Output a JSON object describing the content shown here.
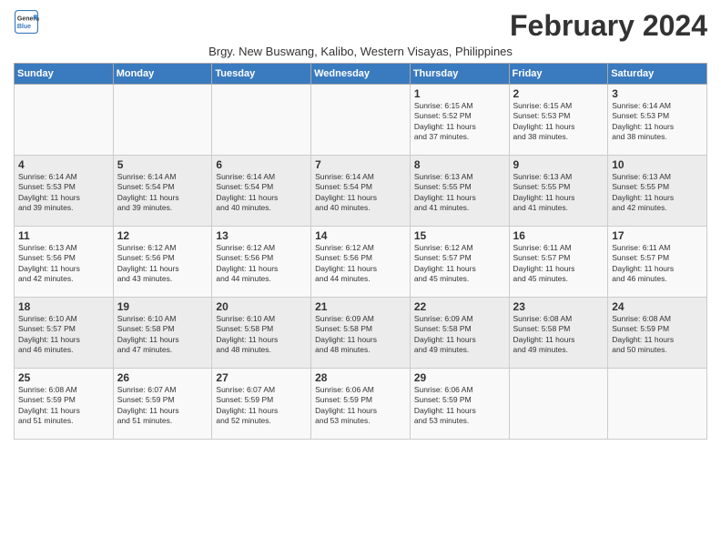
{
  "logo": {
    "line1": "General",
    "line2": "Blue"
  },
  "title": "February 2024",
  "subtitle": "Brgy. New Buswang, Kalibo, Western Visayas, Philippines",
  "weekdays": [
    "Sunday",
    "Monday",
    "Tuesday",
    "Wednesday",
    "Thursday",
    "Friday",
    "Saturday"
  ],
  "weeks": [
    [
      {
        "day": "",
        "info": ""
      },
      {
        "day": "",
        "info": ""
      },
      {
        "day": "",
        "info": ""
      },
      {
        "day": "",
        "info": ""
      },
      {
        "day": "1",
        "info": "Sunrise: 6:15 AM\nSunset: 5:52 PM\nDaylight: 11 hours\nand 37 minutes."
      },
      {
        "day": "2",
        "info": "Sunrise: 6:15 AM\nSunset: 5:53 PM\nDaylight: 11 hours\nand 38 minutes."
      },
      {
        "day": "3",
        "info": "Sunrise: 6:14 AM\nSunset: 5:53 PM\nDaylight: 11 hours\nand 38 minutes."
      }
    ],
    [
      {
        "day": "4",
        "info": "Sunrise: 6:14 AM\nSunset: 5:53 PM\nDaylight: 11 hours\nand 39 minutes."
      },
      {
        "day": "5",
        "info": "Sunrise: 6:14 AM\nSunset: 5:54 PM\nDaylight: 11 hours\nand 39 minutes."
      },
      {
        "day": "6",
        "info": "Sunrise: 6:14 AM\nSunset: 5:54 PM\nDaylight: 11 hours\nand 40 minutes."
      },
      {
        "day": "7",
        "info": "Sunrise: 6:14 AM\nSunset: 5:54 PM\nDaylight: 11 hours\nand 40 minutes."
      },
      {
        "day": "8",
        "info": "Sunrise: 6:13 AM\nSunset: 5:55 PM\nDaylight: 11 hours\nand 41 minutes."
      },
      {
        "day": "9",
        "info": "Sunrise: 6:13 AM\nSunset: 5:55 PM\nDaylight: 11 hours\nand 41 minutes."
      },
      {
        "day": "10",
        "info": "Sunrise: 6:13 AM\nSunset: 5:55 PM\nDaylight: 11 hours\nand 42 minutes."
      }
    ],
    [
      {
        "day": "11",
        "info": "Sunrise: 6:13 AM\nSunset: 5:56 PM\nDaylight: 11 hours\nand 42 minutes."
      },
      {
        "day": "12",
        "info": "Sunrise: 6:12 AM\nSunset: 5:56 PM\nDaylight: 11 hours\nand 43 minutes."
      },
      {
        "day": "13",
        "info": "Sunrise: 6:12 AM\nSunset: 5:56 PM\nDaylight: 11 hours\nand 44 minutes."
      },
      {
        "day": "14",
        "info": "Sunrise: 6:12 AM\nSunset: 5:56 PM\nDaylight: 11 hours\nand 44 minutes."
      },
      {
        "day": "15",
        "info": "Sunrise: 6:12 AM\nSunset: 5:57 PM\nDaylight: 11 hours\nand 45 minutes."
      },
      {
        "day": "16",
        "info": "Sunrise: 6:11 AM\nSunset: 5:57 PM\nDaylight: 11 hours\nand 45 minutes."
      },
      {
        "day": "17",
        "info": "Sunrise: 6:11 AM\nSunset: 5:57 PM\nDaylight: 11 hours\nand 46 minutes."
      }
    ],
    [
      {
        "day": "18",
        "info": "Sunrise: 6:10 AM\nSunset: 5:57 PM\nDaylight: 11 hours\nand 46 minutes."
      },
      {
        "day": "19",
        "info": "Sunrise: 6:10 AM\nSunset: 5:58 PM\nDaylight: 11 hours\nand 47 minutes."
      },
      {
        "day": "20",
        "info": "Sunrise: 6:10 AM\nSunset: 5:58 PM\nDaylight: 11 hours\nand 48 minutes."
      },
      {
        "day": "21",
        "info": "Sunrise: 6:09 AM\nSunset: 5:58 PM\nDaylight: 11 hours\nand 48 minutes."
      },
      {
        "day": "22",
        "info": "Sunrise: 6:09 AM\nSunset: 5:58 PM\nDaylight: 11 hours\nand 49 minutes."
      },
      {
        "day": "23",
        "info": "Sunrise: 6:08 AM\nSunset: 5:58 PM\nDaylight: 11 hours\nand 49 minutes."
      },
      {
        "day": "24",
        "info": "Sunrise: 6:08 AM\nSunset: 5:59 PM\nDaylight: 11 hours\nand 50 minutes."
      }
    ],
    [
      {
        "day": "25",
        "info": "Sunrise: 6:08 AM\nSunset: 5:59 PM\nDaylight: 11 hours\nand 51 minutes."
      },
      {
        "day": "26",
        "info": "Sunrise: 6:07 AM\nSunset: 5:59 PM\nDaylight: 11 hours\nand 51 minutes."
      },
      {
        "day": "27",
        "info": "Sunrise: 6:07 AM\nSunset: 5:59 PM\nDaylight: 11 hours\nand 52 minutes."
      },
      {
        "day": "28",
        "info": "Sunrise: 6:06 AM\nSunset: 5:59 PM\nDaylight: 11 hours\nand 53 minutes."
      },
      {
        "day": "29",
        "info": "Sunrise: 6:06 AM\nSunset: 5:59 PM\nDaylight: 11 hours\nand 53 minutes."
      },
      {
        "day": "",
        "info": ""
      },
      {
        "day": "",
        "info": ""
      }
    ]
  ]
}
